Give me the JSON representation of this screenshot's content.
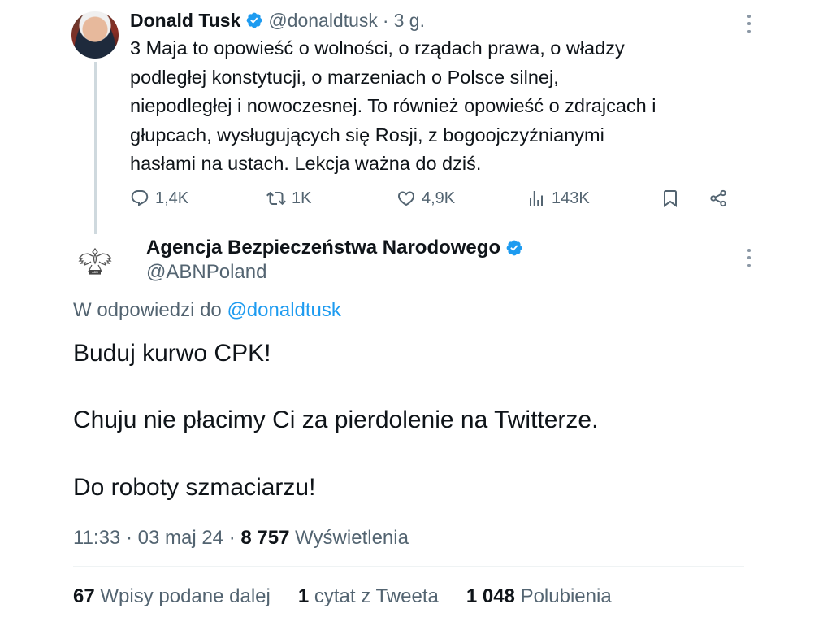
{
  "parent_tweet": {
    "author_name": "Donald Tusk",
    "handle": "@donaldtusk",
    "separator": "·",
    "time": "3 g.",
    "text_lines": [
      "3 Maja to opowieść o wolności, o rządach prawa, o władzy",
      "podległej konstytucji, o marzeniach o Polsce silnej,",
      "niepodległej i nowoczesnej. To również opowieść o zdrajcach i",
      "głupcach, wysługujących się Rosji, z bogoojczyźnianymi",
      "hasłami na ustach. Lekcja ważna do dziś."
    ],
    "actions": {
      "replies": "1,4K",
      "reposts": "1K",
      "likes": "4,9K",
      "views": "143K"
    }
  },
  "main_tweet": {
    "author_name": "Agencja Bezpieczeństwa Narodowego",
    "handle": "@ABNPoland",
    "reply_prefix": "W odpowiedzi do",
    "reply_to_handle": "@donaldtusk",
    "text_lines": [
      "Buduj kurwo CPK!",
      "Chuju nie płacimy Ci za pierdolenie na Twitterze.",
      "Do roboty szmaciarzu!"
    ],
    "meta": {
      "time": "11:33",
      "sep1": "·",
      "date": "03 maj 24",
      "sep2": "·",
      "views_count": "8 757",
      "views_label": "Wyświetlenia"
    },
    "stats": {
      "reposts_count": "67",
      "reposts_label": "Wpisy podane dalej",
      "quotes_count": "1",
      "quotes_label": "cytat z Tweeta",
      "likes_count": "1 048",
      "likes_label": "Polubienia"
    }
  },
  "colors": {
    "text_primary": "#0f1419",
    "text_secondary": "#536471",
    "accent": "#1d9bf0",
    "verified_badge": "#1d9bf0",
    "thread_line": "#cfd9de"
  },
  "icons": [
    "verified-badge-icon",
    "more-options-icon",
    "reply-icon",
    "repost-icon",
    "like-icon",
    "views-icon",
    "bookmark-icon",
    "share-icon",
    "eagle-emblem-icon"
  ]
}
